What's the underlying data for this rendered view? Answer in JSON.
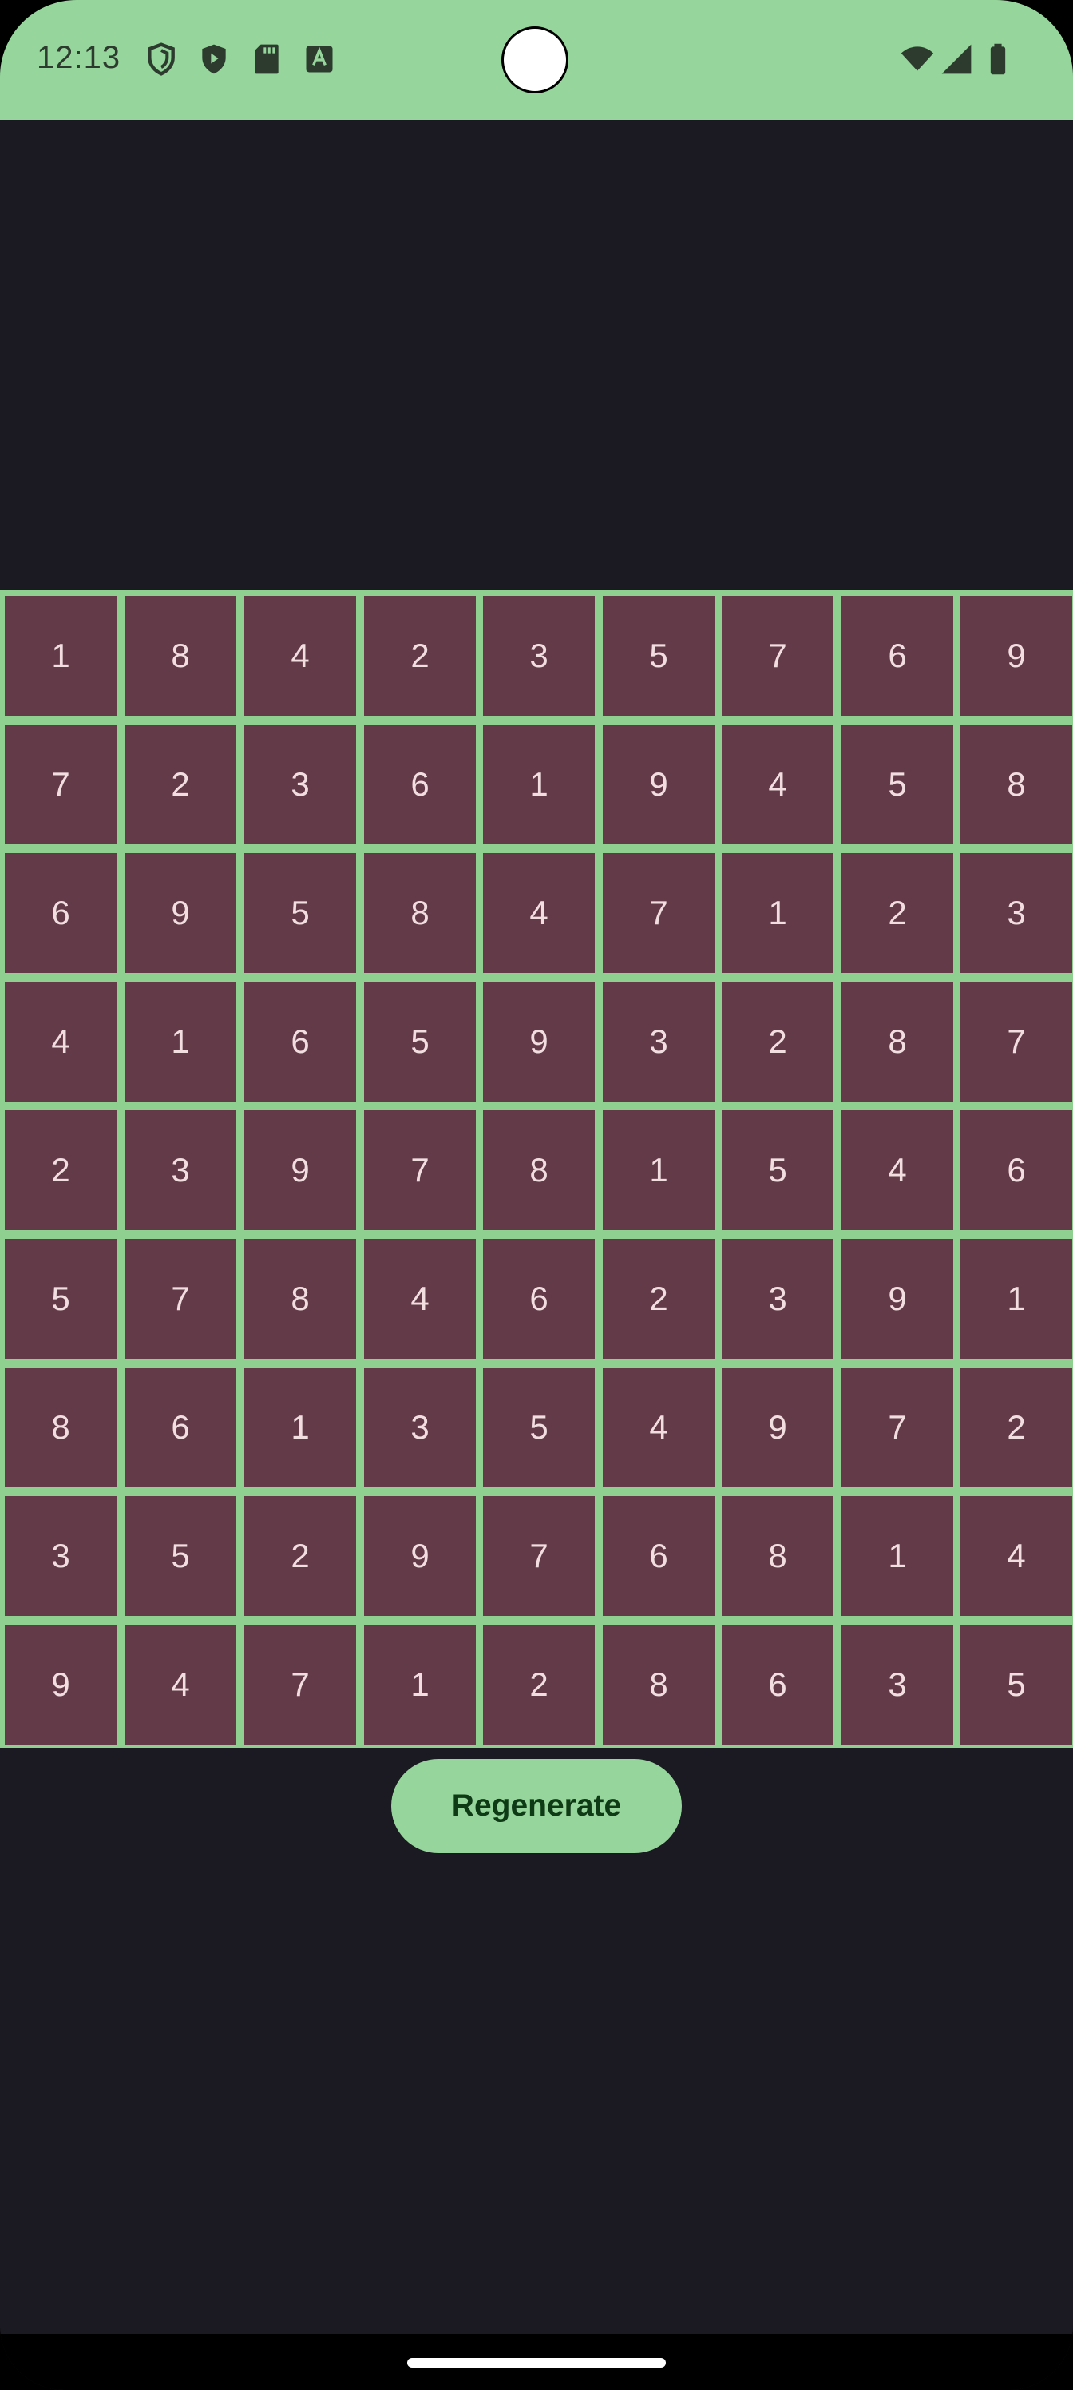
{
  "status_bar": {
    "time": "12:13",
    "icons_left": [
      "shield-outline-icon",
      "shield-play-icon",
      "sd-card-icon",
      "text-a-icon"
    ],
    "icons_right": [
      "wifi-icon",
      "signal-icon",
      "battery-icon"
    ]
  },
  "grid": [
    [
      "1",
      "8",
      "4",
      "2",
      "3",
      "5",
      "7",
      "6",
      "9"
    ],
    [
      "7",
      "2",
      "3",
      "6",
      "1",
      "9",
      "4",
      "5",
      "8"
    ],
    [
      "6",
      "9",
      "5",
      "8",
      "4",
      "7",
      "1",
      "2",
      "3"
    ],
    [
      "4",
      "1",
      "6",
      "5",
      "9",
      "3",
      "2",
      "8",
      "7"
    ],
    [
      "2",
      "3",
      "9",
      "7",
      "8",
      "1",
      "5",
      "4",
      "6"
    ],
    [
      "5",
      "7",
      "8",
      "4",
      "6",
      "2",
      "3",
      "9",
      "1"
    ],
    [
      "8",
      "6",
      "1",
      "3",
      "5",
      "4",
      "9",
      "7",
      "2"
    ],
    [
      "3",
      "5",
      "2",
      "9",
      "7",
      "6",
      "8",
      "1",
      "4"
    ],
    [
      "9",
      "4",
      "7",
      "1",
      "2",
      "8",
      "6",
      "3",
      "5"
    ]
  ],
  "regenerate_label": "Regenerate",
  "colors": {
    "accent": "#96d59b",
    "cell": "#633b48",
    "background": "#1b1a22",
    "cell_text": "#f2dde1"
  }
}
